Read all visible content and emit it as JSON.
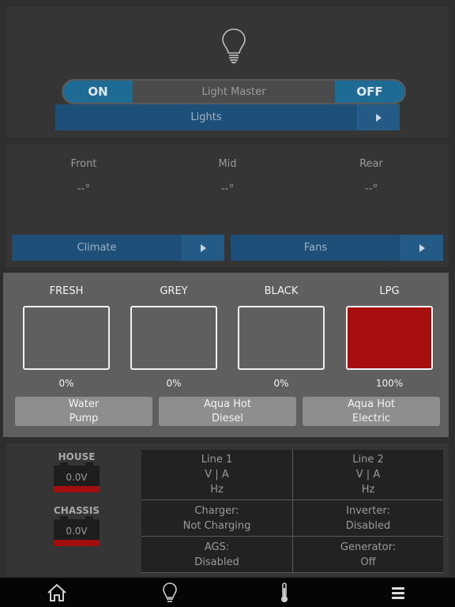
{
  "lights": {
    "master_on": "ON",
    "master_title": "Light Master",
    "master_off": "OFF",
    "nav_label": "Lights"
  },
  "climate": {
    "zones": [
      {
        "name": "Front",
        "temp": "--°"
      },
      {
        "name": "Mid",
        "temp": "--°"
      },
      {
        "name": "Rear",
        "temp": "--°"
      }
    ],
    "climate_label": "Climate",
    "fans_label": "Fans"
  },
  "tanks": {
    "items": [
      {
        "name": "FRESH",
        "level": "0%",
        "fraction": 0
      },
      {
        "name": "GREY",
        "level": "0%",
        "fraction": 0
      },
      {
        "name": "BLACK",
        "level": "0%",
        "fraction": 0
      },
      {
        "name": "LPG",
        "level": "100%",
        "fraction": 1.0
      }
    ],
    "buttons": [
      {
        "line1": "Water",
        "line2": "Pump"
      },
      {
        "line1": "Aqua Hot",
        "line2": "Diesel"
      },
      {
        "line1": "Aqua Hot",
        "line2": "Electric"
      }
    ],
    "alert_color": "#a60f0d"
  },
  "power": {
    "batteries": [
      {
        "name": "HOUSE",
        "voltage": "0.0V"
      },
      {
        "name": "CHASSIS",
        "voltage": "0.0V"
      }
    ],
    "line1": {
      "title": "Line 1",
      "units": "V | A",
      "freq": "Hz"
    },
    "line2": {
      "title": "Line 2",
      "units": "V | A",
      "freq": "Hz"
    },
    "charger": {
      "label": "Charger:",
      "value": "Not Charging"
    },
    "inverter": {
      "label": "Inverter:",
      "value": "Disabled"
    },
    "ags": {
      "label": "AGS:",
      "value": "Disabled"
    },
    "generator": {
      "label": "Generator:",
      "value": "Off"
    }
  },
  "bottom_nav": {
    "icons": [
      "home-icon",
      "lightbulb-icon",
      "thermometer-icon",
      "menu-icon"
    ]
  },
  "colors": {
    "accent_blue": "#1e6b95",
    "nav_blue": "#1d4f78",
    "alert_red": "#a60f0d"
  }
}
